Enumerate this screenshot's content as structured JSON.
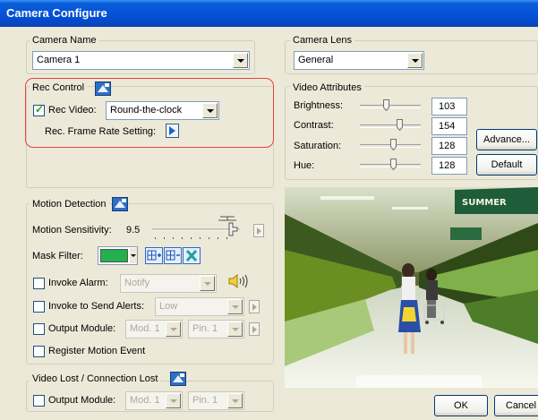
{
  "window": {
    "title": "Camera Configure"
  },
  "camera_name": {
    "legend": "Camera Name",
    "value": "Camera 1"
  },
  "camera_lens": {
    "legend": "Camera Lens",
    "value": "General"
  },
  "rec_control": {
    "legend": "Rec Control",
    "rec_video_label": "Rec Video:",
    "rec_video_checked": true,
    "rec_video_value": "Round-the-clock",
    "frame_rate_label": "Rec. Frame Rate Setting:"
  },
  "video_attributes": {
    "legend": "Video Attributes",
    "brightness": {
      "label": "Brightness:",
      "value": "103"
    },
    "contrast": {
      "label": "Contrast:",
      "value": "154"
    },
    "saturation": {
      "label": "Saturation:",
      "value": "128"
    },
    "hue": {
      "label": "Hue:",
      "value": "128"
    },
    "advance_label": "Advance...",
    "default_label": "Default"
  },
  "motion_detection": {
    "legend": "Motion Detection",
    "sensitivity_label": "Motion Sensitivity:",
    "sensitivity_value": "9.5",
    "mask_filter_label": "Mask Filter:",
    "mask_color": "#22b14c",
    "invoke_alarm": {
      "label": "Invoke Alarm:",
      "checked": false,
      "value": "Notify"
    },
    "invoke_alerts": {
      "label": "Invoke to Send Alerts:",
      "checked": false,
      "value": "Low"
    },
    "output_module": {
      "label": "Output Module:",
      "checked": false,
      "module": "Mod. 1",
      "pin": "Pin. 1"
    },
    "register_event": {
      "label": "Register Motion Event",
      "checked": false
    }
  },
  "video_lost": {
    "legend": "Video Lost / Connection Lost",
    "output_module": {
      "label": "Output Module:",
      "checked": false,
      "module": "Mod. 1",
      "pin": "Pin. 1"
    }
  },
  "preview": {
    "sign_text": "SUMMER"
  },
  "footer": {
    "ok_label": "OK",
    "cancel_label": "Cancel"
  }
}
